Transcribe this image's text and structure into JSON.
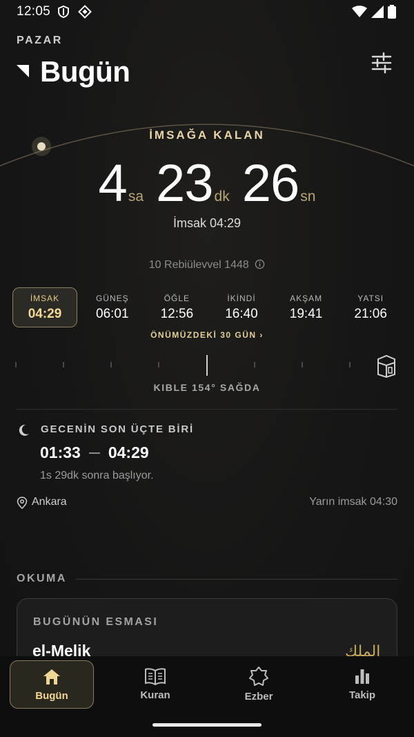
{
  "status_bar": {
    "time": "12:05"
  },
  "header": {
    "day": "PAZAR",
    "title": "Bugün"
  },
  "countdown": {
    "label": "İMSAĞA KALAN",
    "hours": "4",
    "hours_unit": "sa",
    "minutes": "23",
    "minutes_unit": "dk",
    "seconds": "26",
    "seconds_unit": "sn",
    "next_prayer": "İmsak 04:29"
  },
  "hijri_date": "10 Rebiülevvel 1448",
  "prayers": [
    {
      "name": "İMSAK",
      "time": "04:29"
    },
    {
      "name": "GÜNEŞ",
      "time": "06:01"
    },
    {
      "name": "ÖĞLE",
      "time": "12:56"
    },
    {
      "name": "İKİNDİ",
      "time": "16:40"
    },
    {
      "name": "AKŞAM",
      "time": "19:41"
    },
    {
      "name": "YATSI",
      "time": "21:06"
    }
  ],
  "next_days_link": "ÖNÜMÜZDEKİ 30 GÜN",
  "qibla": {
    "label": "KIBLE 154° SAĞDA"
  },
  "night": {
    "title": "GECENİN SON ÜÇTE BİRİ",
    "start": "01:33",
    "end": "04:29",
    "note": "1s 29dk sonra başlıyor."
  },
  "location": "Ankara",
  "tomorrow_imsak": "Yarın imsak 04:30",
  "reading": {
    "section_title": "OKUMA",
    "card_label": "BUGÜNÜN ESMASI",
    "esma_name": "el-Melik",
    "esma_arabic": "الملك"
  },
  "nav": [
    {
      "label": "Bugün"
    },
    {
      "label": "Kuran"
    },
    {
      "label": "Ezber"
    },
    {
      "label": "Takip"
    }
  ],
  "colors": {
    "accent": "#e4cf9a",
    "background": "#151515"
  }
}
